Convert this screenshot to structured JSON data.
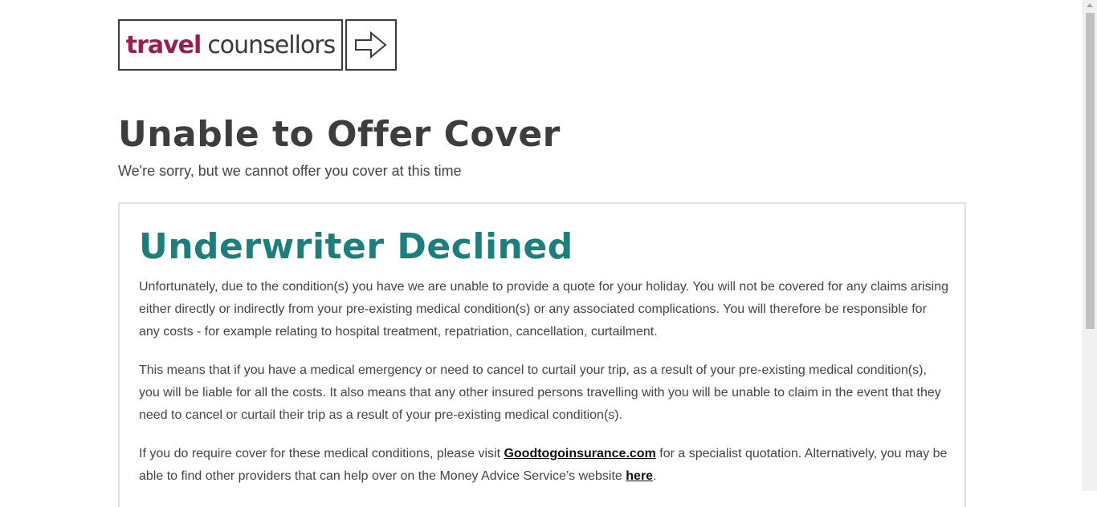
{
  "logo": {
    "word1": "travel",
    "word2": "counsellors",
    "brand_color": "#9b1d4f",
    "arrow_icon": "arrow-right-icon"
  },
  "header": {
    "title": "Unable to Offer Cover",
    "subtitle": "We're sorry, but we cannot offer you cover at this time"
  },
  "panel": {
    "title": "Underwriter Declined",
    "title_color": "#1b7f7b",
    "p1": "Unfortunately, due to the condition(s) you have we are unable to provide a quote for your holiday. You will not be covered for any claims arising either directly or indirectly from your pre-existing medical condition(s) or any associated complications. You will therefore be responsible for any costs - for example relating to hospital treatment, repatriation, cancellation, curtailment.",
    "p2": "This means that if you have a medical emergency or need to cancel to curtail your trip, as a result of your pre-existing medical condition(s), you will be liable for all the costs. It also means that any other insured persons travelling with you will be unable to claim in the event that they need to cancel or curtail their trip as a result of your pre-existing medical condition(s).",
    "p3_before": "If you do require cover for these medical conditions, please visit ",
    "p3_link1": "Goodtogoinsurance.com",
    "p3_middle": " for a specialist quotation. Alternatively, you may be able to find other providers that can help over on the Money Advice Service’s website ",
    "p3_link2": "here",
    "p3_after": "."
  }
}
